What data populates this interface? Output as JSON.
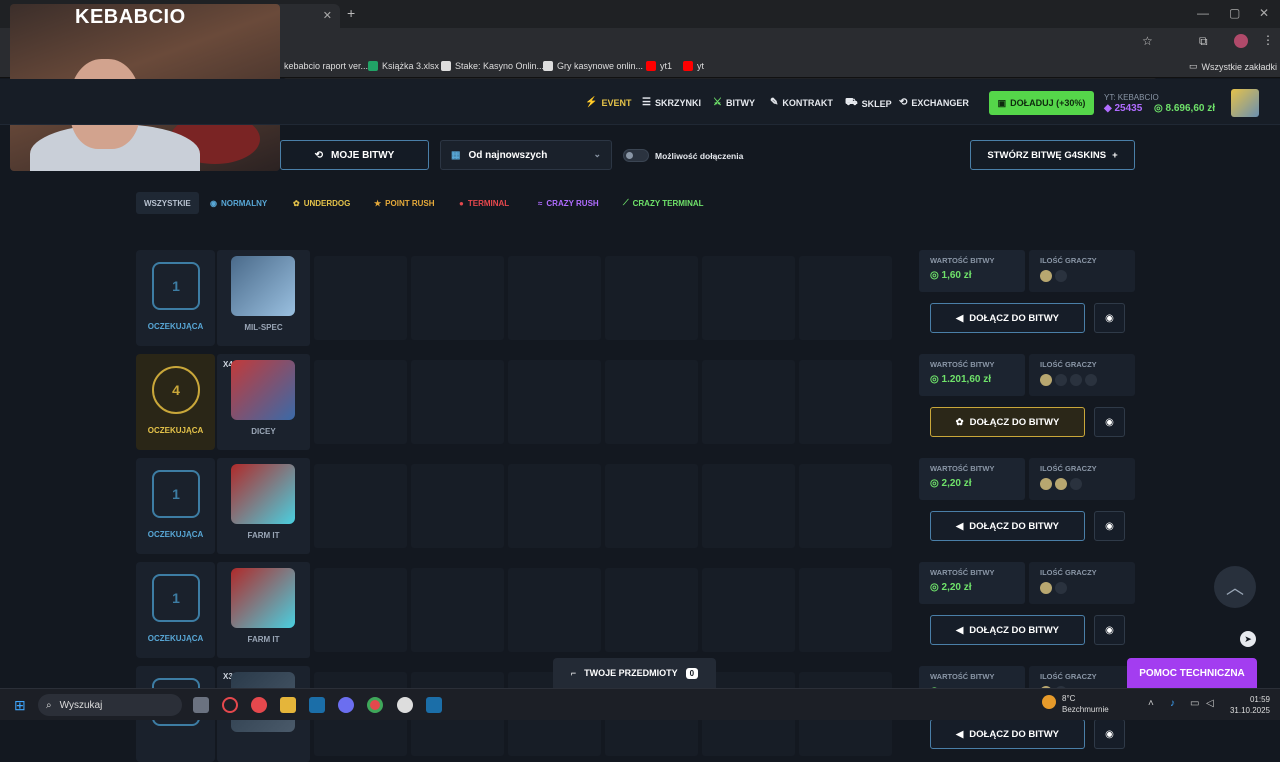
{
  "browser": {
    "tab_title": "gle",
    "bookmarks": [
      {
        "label": "kebabcio raport ver...",
        "color": "#2d6cdf"
      },
      {
        "label": "Książka 3.xlsx",
        "color": "#21a366"
      },
      {
        "label": "Stake: Kasyno Onlin...",
        "color": "#dddddd"
      },
      {
        "label": "Gry kasynowe onlin...",
        "color": "#dddddd"
      },
      {
        "label": "yt1",
        "color": "#ff0000"
      },
      {
        "label": "yt",
        "color": "#ff0000"
      }
    ],
    "all_bookmarks": "Wszystkie zakładki"
  },
  "webcam": {
    "title": "KEBABCIO"
  },
  "nav": {
    "event": "EVENT",
    "cases": "SKRZYNKI",
    "battles": "BITWY",
    "contract": "KONTRAKT",
    "shop": "SKLEP",
    "exchanger": "EXCHANGER"
  },
  "account": {
    "topup": "DOŁADUJ (+30%)",
    "yt": "YT: KEBABCIO",
    "points": "25435",
    "balance": "8.696,60 zł"
  },
  "toolbar": {
    "my_battles": "MOJE BITWY",
    "sort": "Od najnowszych",
    "joinable_label": "Możliwość dołączenia",
    "create": "STWÓRZ BITWĘ G4SKINS"
  },
  "filters": [
    {
      "label": "WSZYSTKIE",
      "color": "#b8c2d0"
    },
    {
      "label": "NORMALNY",
      "color": "#58a7d6"
    },
    {
      "label": "UNDERDOG",
      "color": "#e5c34a"
    },
    {
      "label": "POINT RUSH",
      "color": "#e5a93a"
    },
    {
      "label": "TERMINAL",
      "color": "#e5484d"
    },
    {
      "label": "CRAZY RUSH",
      "color": "#b06cff"
    },
    {
      "label": "CRAZY TERMINAL",
      "color": "#6fe26a"
    }
  ],
  "battle_labels": {
    "value": "WARTOŚĆ BITWY",
    "players": "ILOŚĆ GRACZY",
    "join": "DOŁĄCZ DO BITWY"
  },
  "battles": [
    {
      "status": "OCZEKUJĄCA",
      "case": "MIL-SPEC",
      "mult": "",
      "value": "1,60 zł",
      "emblem": "1"
    },
    {
      "status": "OCZEKUJĄCA",
      "case": "DICEY",
      "mult": "X4",
      "value": "1.201,60 zł",
      "emblem": "4"
    },
    {
      "status": "OCZEKUJĄCA",
      "case": "FARM IT",
      "mult": "",
      "value": "2,20 zł",
      "emblem": "1"
    },
    {
      "status": "OCZEKUJĄCA",
      "case": "FARM IT",
      "mult": "",
      "value": "2,20 zł",
      "emblem": "1"
    },
    {
      "status": "",
      "case": "",
      "mult": "X3",
      "value": "",
      "emblem": ""
    }
  ],
  "floating": {
    "items": "TWOJE PRZEDMIOTY",
    "items_count": "0",
    "help": "POMOC TECHNICZNA"
  },
  "taskbar": {
    "search": "Wyszukaj",
    "temp": "8°C",
    "weather": "Bezchmurnie",
    "time": "01:59",
    "date": "31.10.2025"
  }
}
